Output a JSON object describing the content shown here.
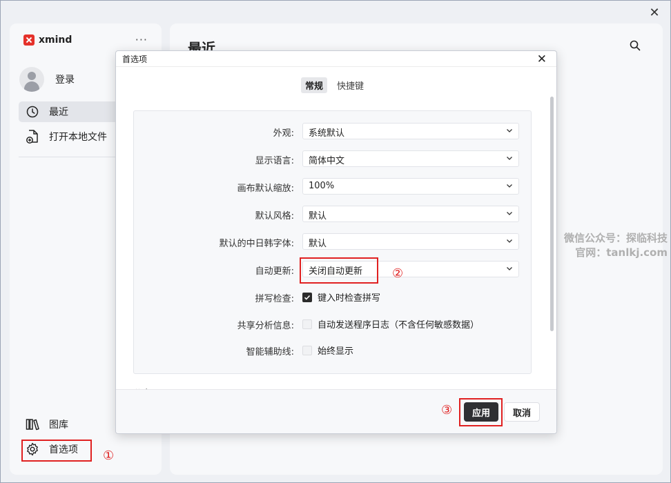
{
  "app": {
    "brand": "xmind",
    "user_label": "登录",
    "nav": {
      "recent": "最近",
      "open_local": "打开本地文件",
      "library": "图库",
      "preferences": "首选项"
    },
    "main_title": "最近"
  },
  "dialog": {
    "title": "首选项",
    "tabs": {
      "general": "常规",
      "shortcuts": "快捷键"
    },
    "settings": {
      "appearance": {
        "label": "外观:",
        "value": "系统默认"
      },
      "language": {
        "label": "显示语言:",
        "value": "简体中文"
      },
      "zoom": {
        "label": "画布默认缩放:",
        "value": "100%"
      },
      "style": {
        "label": "默认风格:",
        "value": "默认"
      },
      "cjk_font": {
        "label": "默认的中日韩字体:",
        "value": "默认"
      },
      "auto_update": {
        "label": "自动更新:",
        "value": "关闭自动更新"
      },
      "spellcheck": {
        "label": "拼写检查:",
        "text": "键入时检查拼写",
        "checked": true
      },
      "analytics": {
        "label": "共享分析信息:",
        "text": "自动发送程序日志（不含任何敏感数据）",
        "checked": false
      },
      "guides": {
        "label": "智能辅助线:",
        "text": "始终显示",
        "checked": false
      }
    },
    "next_section": "分享",
    "buttons": {
      "apply": "应用",
      "cancel": "取消"
    }
  },
  "annotations": {
    "one": "①",
    "two": "②",
    "three": "③"
  },
  "watermark": {
    "line1": "微信公众号：探临科技",
    "line2": "官网：tanlkj.com"
  },
  "colors": {
    "accent_red": "#e02020",
    "dark_button": "#2f3033",
    "brand_red": "#e5312a"
  }
}
